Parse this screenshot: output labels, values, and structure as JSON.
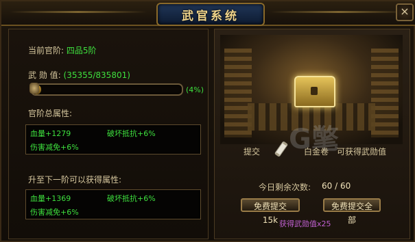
{
  "window": {
    "title": "武官系统",
    "close_glyph": "×"
  },
  "left": {
    "current_rank_label": "当前官阶:",
    "current_rank_value": "四品5阶",
    "merit_label": "武 勋 值:",
    "merit_value": "(35355/835801)",
    "merit_progress": 0.04,
    "merit_percent": "(4%)",
    "total_attr_title": "官阶总属性:",
    "total_attrs": {
      "a1": "血量+1279",
      "a2": "破坏抵抗+6%",
      "a3": "伤害减免+6%"
    },
    "next_attr_title": "升至下一阶可以获得属性:",
    "next_attrs": {
      "a1": "血量+1369",
      "a2": "破坏抵抗+6%",
      "a3": "伤害减免+6%"
    }
  },
  "right": {
    "submit_label": "提交",
    "item_name": "白金卷",
    "gain_text": "可获得武勋值",
    "remaining_label": "今日剩余次数:",
    "remaining_value": "60 / 60",
    "btn_free_submit": "免费提交15k",
    "btn_free_all": "免费提交全部",
    "gain_note": "获得武勋值x25",
    "watermark": "G氅"
  },
  "colors": {
    "accent_green": "#3ee03e",
    "accent_gold": "#f0d48a",
    "note_purple": "#c060d0"
  }
}
